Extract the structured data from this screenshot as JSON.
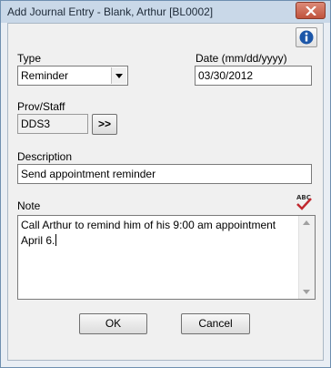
{
  "window": {
    "title": "Add Journal Entry - Blank, Arthur  [BL0002]"
  },
  "form": {
    "type": {
      "label": "Type",
      "value": "Reminder"
    },
    "date": {
      "label": "Date (mm/dd/yyyy)",
      "value": "03/30/2012"
    },
    "prov_staff": {
      "label": "Prov/Staff",
      "value": "DDS3",
      "browse_label": ">>"
    },
    "description": {
      "label": "Description",
      "value": "Send appointment reminder"
    },
    "note": {
      "label": "Note",
      "value": "Call Arthur to remind him of his 9:00 am appointment April 6."
    }
  },
  "buttons": {
    "ok": "OK",
    "cancel": "Cancel"
  },
  "icons": {
    "info": "info-icon",
    "spell_check": "spell-check-icon",
    "close": "close-icon",
    "dropdown": "chevron-down-icon"
  },
  "colors": {
    "title_bar": "#c9d8e8",
    "close_button": "#c75d46",
    "info_icon": "#1c56a8",
    "spell_check": "#c0282e"
  }
}
